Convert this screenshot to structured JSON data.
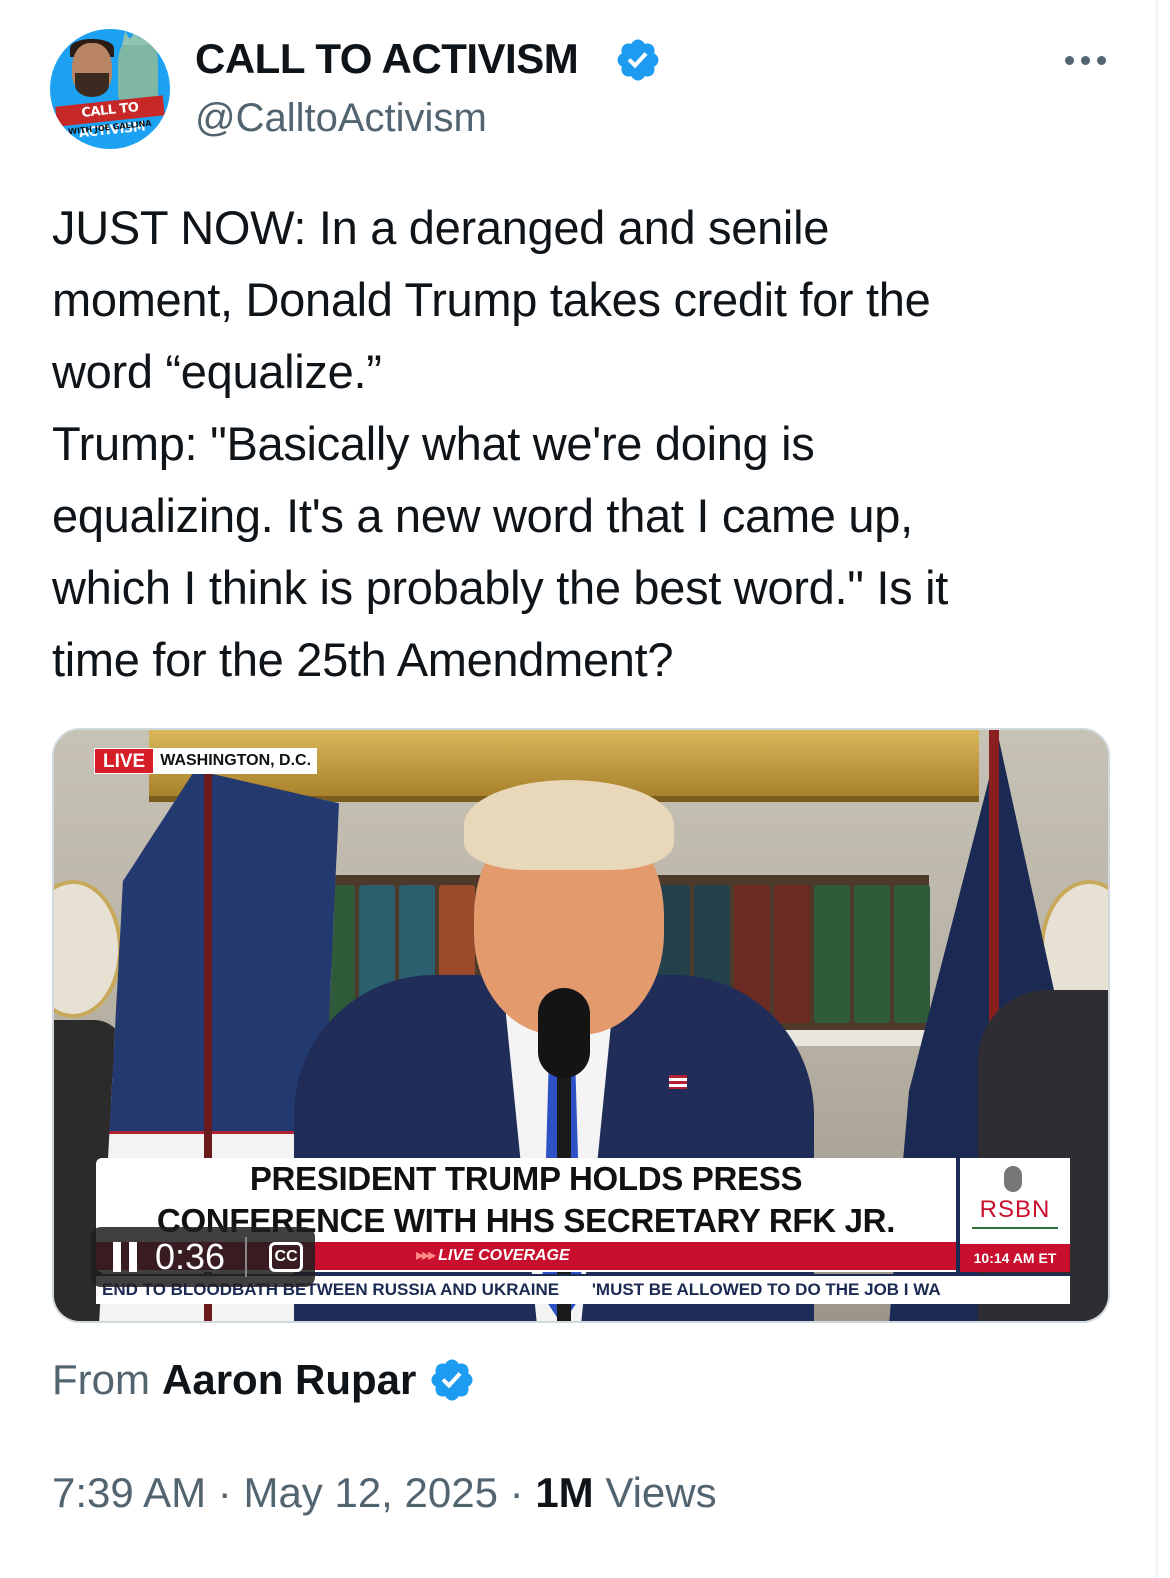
{
  "author": {
    "display_name": "CALL TO ACTIVISM",
    "handle": "@CalltoActivism",
    "avatar_banner": "CALL TO ACTIVISM",
    "avatar_sub": "WITH JOE GALLINA",
    "verified": true
  },
  "tweet": {
    "text_lines": [
      "JUST NOW: In a deranged and senile",
      "moment, Donald Trump takes credit for the",
      "word “equalize.”",
      "Trump: \"Basically what we're doing is",
      "equalizing. It's a new word that I came up,",
      "which I think is probably the best word.\" Is it",
      "time for the 25th Amendment?"
    ]
  },
  "video": {
    "live_label": "LIVE",
    "location": "WASHINGTON, D.C.",
    "headline_line1": "PRESIDENT TRUMP HOLDS PRESS",
    "headline_line2": "CONFERENCE WITH HHS SECRETARY RFK JR.",
    "live_coverage": "LIVE COVERAGE",
    "network": "RSBN",
    "clock": "10:14 AM ET",
    "ticker_1": "END TO BLOODBATH BETWEEN RUSSIA AND UKRAINE",
    "ticker_2": "'MUST BE ALLOWED TO DO THE JOB I WA",
    "elapsed": "0:36",
    "cc_label": "CC",
    "state": "playing"
  },
  "attribution": {
    "from_label": "From",
    "name": "Aaron Rupar",
    "verified": true
  },
  "meta": {
    "time": "7:39 AM",
    "separator": "·",
    "date": "May 12, 2025",
    "views_count": "1M",
    "views_label": "Views"
  },
  "colors": {
    "verified_blue": "#1d9bf0",
    "secondary_text": "#536471",
    "primary_text": "#0f1419",
    "live_red": "#d71d25"
  },
  "icons": [
    "verified-badge-icon",
    "more-options-icon",
    "pause-icon",
    "closed-captions-icon"
  ]
}
